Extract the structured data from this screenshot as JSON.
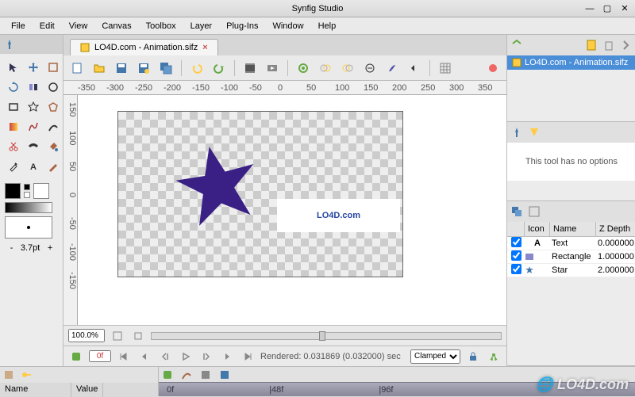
{
  "window": {
    "title": "Synfig Studio"
  },
  "menu": [
    "File",
    "Edit",
    "View",
    "Canvas",
    "Toolbox",
    "Layer",
    "Plug-Ins",
    "Window",
    "Help"
  ],
  "doc": {
    "tab_label": "LO4D.com - Animation.sifz"
  },
  "tools": {
    "items": [
      "transform-tool",
      "move-tool",
      "scale-tool",
      "rotate-tool",
      "mirror-tool",
      "circle-tool",
      "rectangle-tool",
      "star-tool",
      "polygon-tool",
      "gradient-tool",
      "spline-tool",
      "draw-tool",
      "cut-tool",
      "width-tool",
      "fill-tool",
      "eyedropper-tool",
      "text-tool",
      "sketch-tool"
    ],
    "fg_color": "#000000",
    "bg_color": "#ffffff",
    "brush_pt": "3.7pt"
  },
  "ruler_h": [
    "-350",
    "-300",
    "-250",
    "-200",
    "-150",
    "-100",
    "-50",
    "0",
    "50",
    "100",
    "150",
    "200",
    "250",
    "300",
    "350"
  ],
  "ruler_v": [
    "150",
    "100",
    "50",
    "0",
    "-50",
    "-100",
    "-150"
  ],
  "canvas": {
    "star_color": "#3a1f85",
    "text": "LO4D.com"
  },
  "zoom": "100.0%",
  "frame": "0f",
  "render_status": "Rendered: 0.031869 (0.032000) sec",
  "clamp_mode": "Clamped",
  "right": {
    "canvas_item": "LO4D.com - Animation.sifz",
    "tool_options_msg": "This tool has no options",
    "layers_headers": {
      "icon": "Icon",
      "name": "Name",
      "z": "Z Depth"
    },
    "layers": [
      {
        "checked": true,
        "icon": "text",
        "name": "Text",
        "z": "0.000000"
      },
      {
        "checked": true,
        "icon": "rect",
        "name": "Rectangle",
        "z": "1.000000"
      },
      {
        "checked": true,
        "icon": "star",
        "name": "Star",
        "z": "2.000000"
      }
    ]
  },
  "params": {
    "col_name": "Name",
    "col_value": "Value"
  },
  "timeline": {
    "marks": [
      "0f",
      "|48f",
      "|96f"
    ]
  },
  "watermark": "🌐 LO4D.com"
}
